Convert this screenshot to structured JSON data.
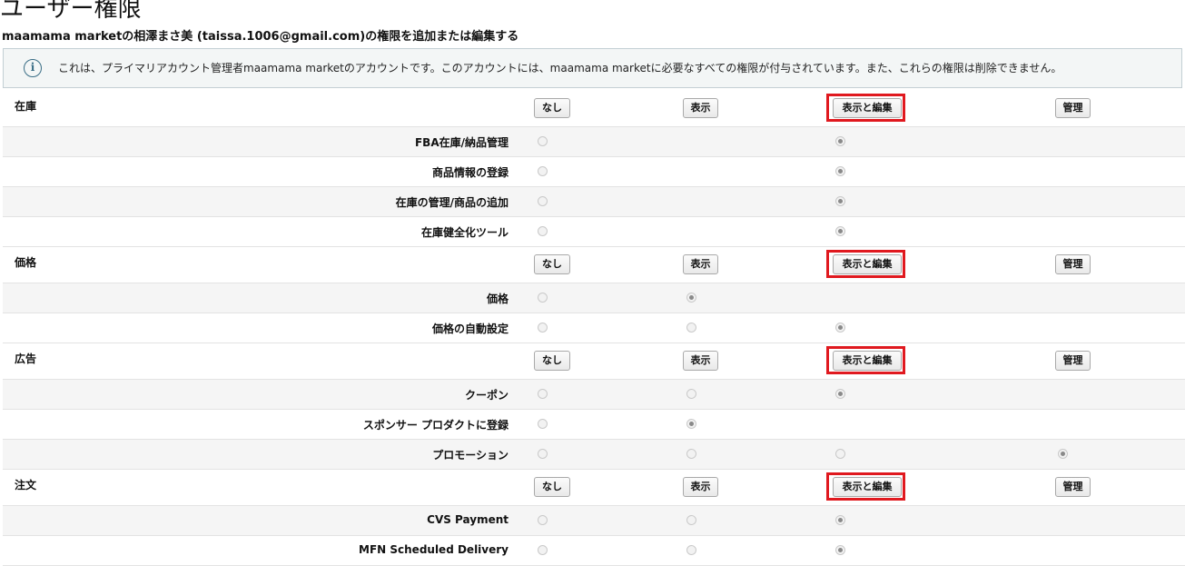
{
  "page": {
    "title": "ユーザー権限",
    "subtitle": "maamama marketの相澤まさ美 (taissa.1006@gmail.com)の権限を追加または編集する"
  },
  "info": {
    "icon": "info-icon",
    "text": "これは、プライマリアカウント管理者maamama marketのアカウントです。このアカウントには、maamama marketに必要なすべての権限が付与されています。また、これらの権限は削除できません。"
  },
  "levels": {
    "none": "なし",
    "view": "表示",
    "edit": "表示と編集",
    "admin": "管理"
  },
  "highlight_color": "#e0191f",
  "categories": [
    {
      "name": "在庫",
      "highlight": true,
      "permissions": [
        {
          "name": "FBA在庫/納品管理",
          "options": [
            0,
            2
          ],
          "selected": 2
        },
        {
          "name": "商品情報の登録",
          "options": [
            0,
            2
          ],
          "selected": 2
        },
        {
          "name": "在庫の管理/商品の追加",
          "options": [
            0,
            2
          ],
          "selected": 2
        },
        {
          "name": "在庫健全化ツール",
          "options": [
            0,
            2
          ],
          "selected": 2
        }
      ]
    },
    {
      "name": "価格",
      "highlight": true,
      "permissions": [
        {
          "name": "価格",
          "options": [
            0,
            1
          ],
          "selected": 1
        },
        {
          "name": "価格の自動設定",
          "options": [
            0,
            1,
            2
          ],
          "selected": 2
        }
      ]
    },
    {
      "name": "広告",
      "highlight": true,
      "permissions": [
        {
          "name": "クーポン",
          "options": [
            0,
            1,
            2
          ],
          "selected": 2
        },
        {
          "name": "スポンサー プロダクトに登録",
          "options": [
            0,
            1
          ],
          "selected": 1
        },
        {
          "name": "プロモーション",
          "options": [
            0,
            1,
            2,
            3
          ],
          "selected": 3
        }
      ]
    },
    {
      "name": "注文",
      "highlight": true,
      "permissions": [
        {
          "name": "CVS Payment",
          "options": [
            0,
            1,
            2
          ],
          "selected": 2
        },
        {
          "name": "MFN Scheduled Delivery",
          "options": [
            0,
            1,
            2
          ],
          "selected": 2
        }
      ]
    }
  ]
}
